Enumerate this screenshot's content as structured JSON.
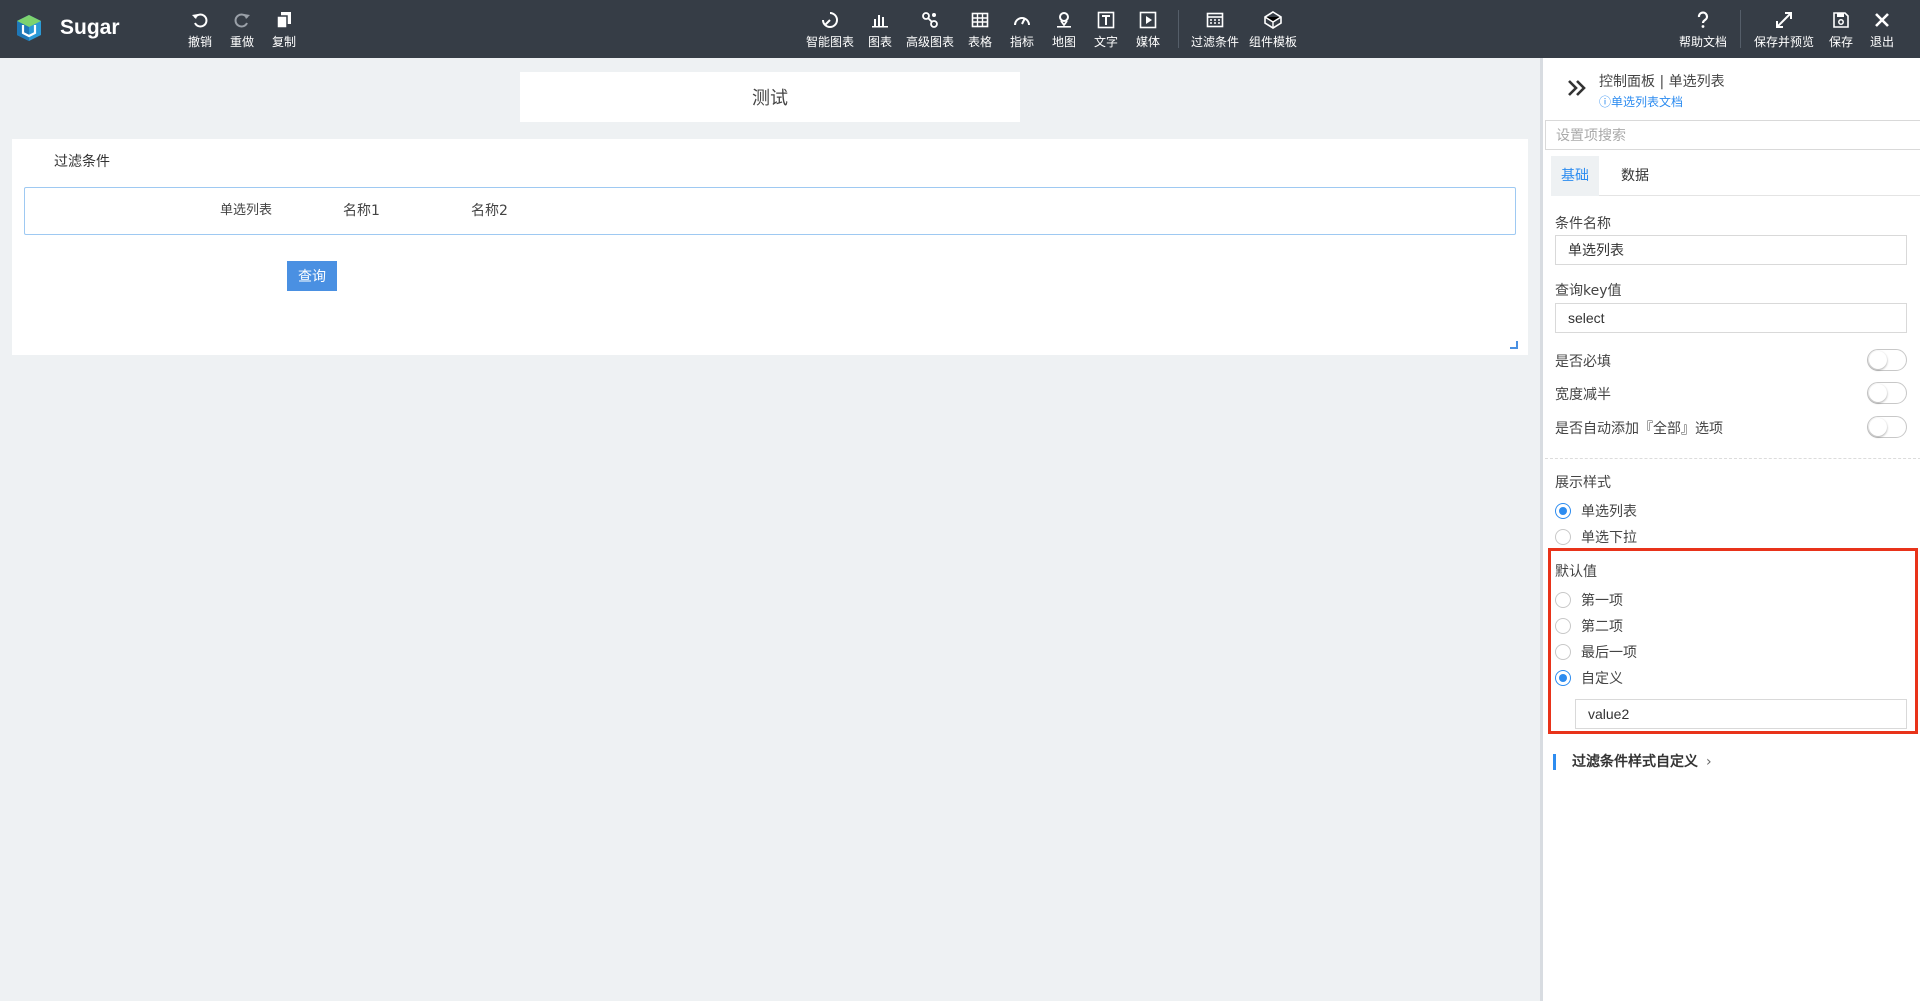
{
  "app": {
    "name": "Sugar"
  },
  "toolbar": {
    "left": [
      {
        "label": "撤销",
        "icon": "undo-icon"
      },
      {
        "label": "重做",
        "icon": "redo-icon"
      },
      {
        "label": "复制",
        "icon": "copy-icon"
      }
    ],
    "center": [
      {
        "label": "智能图表",
        "icon": "smart-chart-icon"
      },
      {
        "label": "图表",
        "icon": "bar-chart-icon"
      },
      {
        "label": "高级图表",
        "icon": "advanced-chart-icon"
      },
      {
        "label": "表格",
        "icon": "table-icon"
      },
      {
        "label": "指标",
        "icon": "gauge-icon"
      },
      {
        "label": "地图",
        "icon": "map-pin-icon"
      },
      {
        "label": "文字",
        "icon": "text-icon"
      },
      {
        "label": "媒体",
        "icon": "media-icon"
      },
      {
        "label": "过滤条件",
        "icon": "filter-icon"
      },
      {
        "label": "组件模板",
        "icon": "template-icon"
      }
    ],
    "right": [
      {
        "label": "帮助文档",
        "icon": "help-icon"
      },
      {
        "label": "保存并预览",
        "icon": "expand-icon"
      },
      {
        "label": "保存",
        "icon": "save-icon"
      },
      {
        "label": "退出",
        "icon": "close-icon"
      }
    ]
  },
  "canvas": {
    "title": "测试",
    "filter_header": "过滤条件",
    "filter_label": "单选列表",
    "options": [
      "名称1",
      "名称2"
    ],
    "query_button": "查询"
  },
  "panel": {
    "title": "控制面板 | 单选列表",
    "doc_link": "单选列表文档",
    "search_placeholder": "设置项搜索",
    "tabs": [
      "基础",
      "数据"
    ],
    "condition_name_label": "条件名称",
    "condition_name_value": "单选列表",
    "query_key_label": "查询key值",
    "query_key_value": "select",
    "switches": [
      {
        "label": "是否必填",
        "on": false
      },
      {
        "label": "宽度减半",
        "on": false
      },
      {
        "label": "是否自动添加『全部』选项",
        "on": false
      }
    ],
    "display_style_label": "展示样式",
    "display_styles": [
      {
        "label": "单选列表",
        "selected": true
      },
      {
        "label": "单选下拉",
        "selected": false
      }
    ],
    "default_label": "默认值",
    "defaults": [
      {
        "label": "第一项",
        "selected": false
      },
      {
        "label": "第二项",
        "selected": false
      },
      {
        "label": "最后一项",
        "selected": false
      },
      {
        "label": "自定义",
        "selected": true
      }
    ],
    "custom_value": "value2",
    "style_custom_link": "过滤条件样式自定义"
  },
  "colors": {
    "accent": "#2d8cf0",
    "topbar": "#363d46",
    "highlight": "#e8331a",
    "button": "#4a90e2"
  }
}
